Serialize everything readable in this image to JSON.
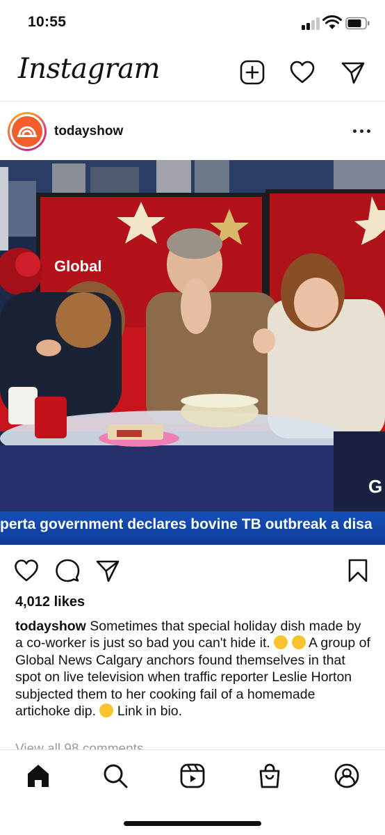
{
  "status_bar": {
    "time": "10:55"
  },
  "header": {
    "logo": "Instagram",
    "icons": [
      "new-post-icon",
      "heart-icon",
      "direct-message-icon"
    ]
  },
  "post": {
    "username": "todayshow",
    "image": {
      "description_icons": [
        "tv-studio-scene"
      ],
      "ticker_text": "perta government declares bovine TB outbreak a disa",
      "station_logo": "Global",
      "corner_letter": "G"
    },
    "actions": [
      "heart-icon",
      "comment-icon",
      "share-icon",
      "bookmark-icon"
    ],
    "likes": "4,012 likes",
    "caption_user": "todayshow",
    "caption_part1": " Sometimes that special holiday dish made by a co-worker is just so bad you can't hide it. ",
    "caption_part2": " A group of Global News Calgary anchors found themselves in that spot on live television when traffic reporter Leslie Horton subjected them to her cooking fail of a homemade artichoke dip. ",
    "caption_part3": " Link in bio.",
    "view_comments": "View all 98 comments"
  },
  "tab_bar": {
    "tabs": [
      "home-icon",
      "search-icon",
      "reels-icon",
      "shop-icon",
      "profile-icon"
    ]
  },
  "colors": {
    "ticker_blue": "#1550b8",
    "avatar_orange": "#f15d2b",
    "set_red": "#b3121b"
  }
}
